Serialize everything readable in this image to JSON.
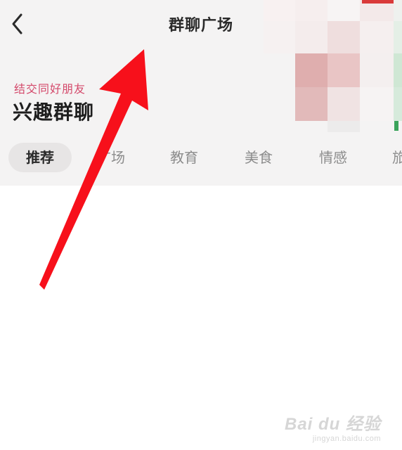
{
  "nav": {
    "title": "群聊广场"
  },
  "hero": {
    "subtitle": "结交同好朋友",
    "title": "兴趣群聊"
  },
  "tabs": [
    {
      "label": "推荐",
      "active": true
    },
    {
      "label": "广场",
      "active": false
    },
    {
      "label": "教育",
      "active": false
    },
    {
      "label": "美食",
      "active": false
    },
    {
      "label": "情感",
      "active": false
    },
    {
      "label": "旅",
      "active": false
    }
  ],
  "colors": {
    "accent": "#d4496b",
    "header_bg": "#f4f3f3",
    "active_tab_bg": "#e7e5e5",
    "annotation_arrow": "#f7101b"
  },
  "watermark": {
    "brand": "Bai du 经验",
    "url": "jingyan.baidu.com"
  }
}
